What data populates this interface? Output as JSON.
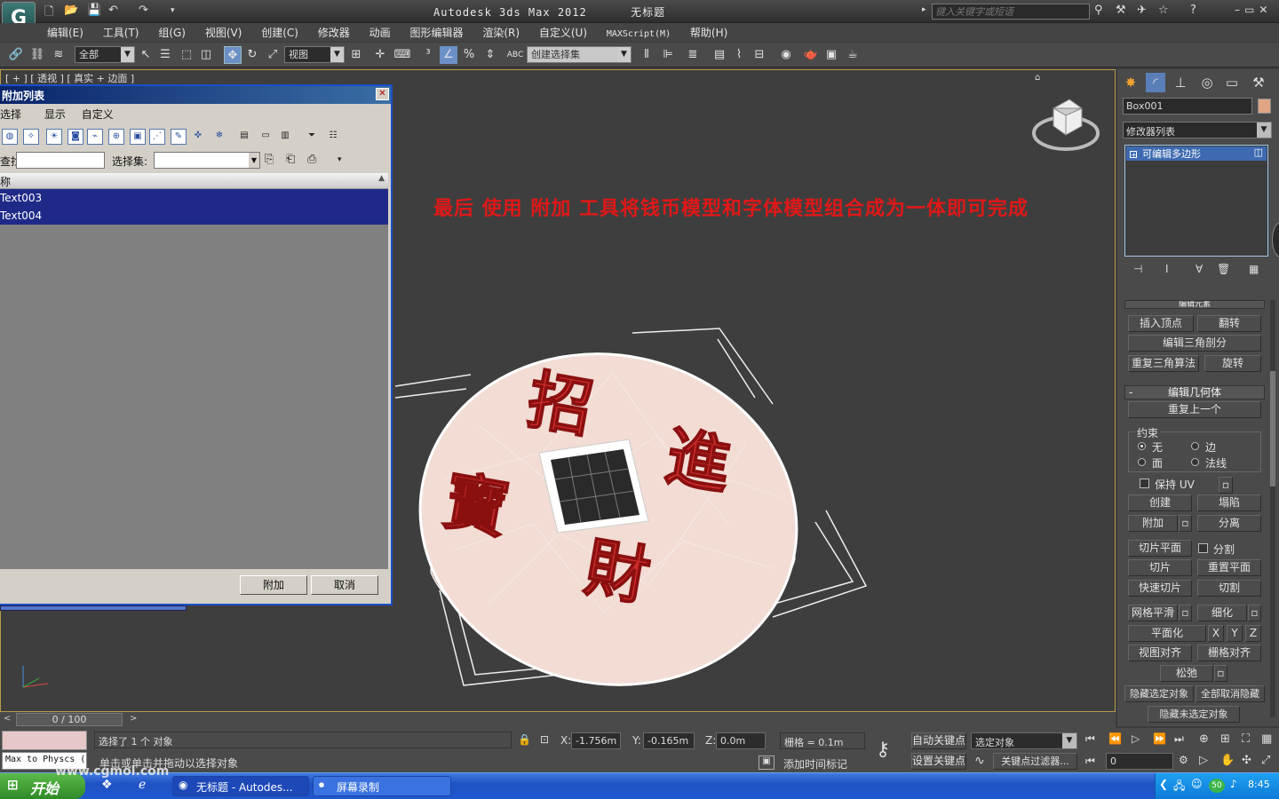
{
  "app": {
    "title": "Autodesk 3ds Max  2012",
    "doc": "无标题",
    "search_placeholder": "键入关键字或短语",
    "logo_letter": "G"
  },
  "menu": [
    "编辑(E)",
    "工具(T)",
    "组(G)",
    "视图(V)",
    "创建(C)",
    "修改器",
    "动画",
    "图形编辑器",
    "渲染(R)",
    "自定义(U)",
    "MAXScript(M)",
    "帮助(H)"
  ],
  "toolbar": {
    "filter_value": "全部",
    "refcoord_value": "视图",
    "selset_value": "创建选择集"
  },
  "viewport": {
    "label": "[ + ] [ 透视 ] [ 真实 + 边面 ]",
    "annotation": "最后 使用 附加 工具将钱币模型和字体模型组合成为一体即可完成",
    "coin_chars": [
      "招",
      "進",
      "財",
      "寶"
    ]
  },
  "dialog": {
    "title": "附加列表",
    "menu": [
      "选择",
      "显示",
      "自定义"
    ],
    "find_label": "查找:",
    "selset_label": "选择集:",
    "col_header": "名称",
    "rows": [
      "Text003",
      "Text004"
    ],
    "ok_label": "附加",
    "cancel_label": "取消"
  },
  "command_panel": {
    "object_name": "Box001",
    "object_color": "#e0a585",
    "modifier_list": "修改器列表",
    "stack_item": "可编辑多边形",
    "edit_elements": "编辑元素",
    "insert_vertex": "插入顶点",
    "flip": "翻转",
    "edit_tri": "编辑三角剖分",
    "retriangulate": "重复三角算法",
    "turn": "旋转",
    "edit_geometry": "编辑几何体",
    "repeat_last": "重复上一个",
    "constraints": "约束",
    "c_none": "无",
    "c_edge": "边",
    "c_face": "面",
    "c_normal": "法线",
    "preserve_uv": "保持 UV",
    "create": "创建",
    "collapse": "塌陷",
    "attach": "附加",
    "detach": "分离",
    "slice_plane": "切片平面",
    "split": "分割",
    "slice": "切片",
    "reset_plane": "重置平面",
    "quickslice": "快速切片",
    "cut": "切割",
    "meshsmooth": "网格平滑",
    "tessellate": "细化",
    "make_planar": "平面化",
    "x": "X",
    "y": "Y",
    "z": "Z",
    "view_align": "视图对齐",
    "grid_align": "栅格对齐",
    "relax": "松弛",
    "hide_selected": "隐藏选定对象",
    "unhide_all": "全部取消隐藏",
    "hide_unselected": "隐藏未选定对象"
  },
  "timeline": {
    "frame": "0 / 100"
  },
  "status": {
    "script_text": "Max to Physcs (",
    "selected": "选择了 1 个 对象",
    "prompt": "单击或单击并拖动以选择对象",
    "x_label": "X:",
    "x_val": "-1.756m",
    "y_label": "Y:",
    "y_val": "-0.165m",
    "z_label": "Z:",
    "z_val": "0.0m",
    "grid": "栅格 = 0.1m",
    "add_time_tag": "添加时间标记",
    "auto_key": "自动关键点",
    "set_key": "设置关键点",
    "key_mode": "选定对象",
    "key_filters": "关键点过滤器...",
    "frame_field": "0"
  },
  "taskbar": {
    "start": "开始",
    "watermark": "www.cgmol.com",
    "tasks": [
      "无标题 - Autodes...",
      "屏幕录制"
    ],
    "clock": "8:45",
    "tray_badge": "50"
  }
}
